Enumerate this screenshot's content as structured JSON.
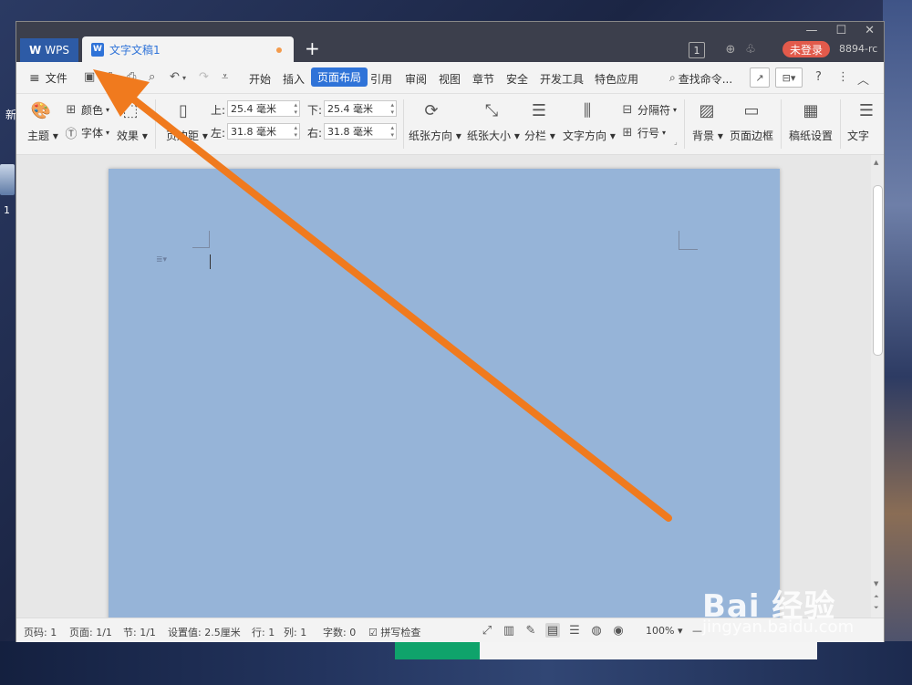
{
  "desktop": {
    "icon_text": "新",
    "icon_number": "1"
  },
  "titlebar": {
    "wps_tab": "WPS",
    "doc_tab": "文字文稿1",
    "doc_icon": "W",
    "new_tab": "+",
    "window_badge": "1",
    "login_button": "未登录",
    "account_id": "8894-rc"
  },
  "menu": {
    "file": "文件",
    "items": [
      "开始",
      "插入",
      "页面布局",
      "引用",
      "审阅",
      "视图",
      "章节",
      "安全",
      "开发工具",
      "特色应用"
    ],
    "active": "页面布局",
    "search": "查找命令..."
  },
  "ribbon": {
    "theme": "主题",
    "color": "颜色",
    "font": "字体",
    "effect": "效果",
    "margins": "页边距",
    "top_label": "上:",
    "top_value": "25.4 毫米",
    "bottom_label": "下:",
    "bottom_value": "25.4 毫米",
    "left_label": "左:",
    "left_value": "31.8 毫米",
    "right_label": "右:",
    "right_value": "31.8 毫米",
    "orientation": "纸张方向",
    "size": "纸张大小",
    "columns": "分栏",
    "text_direction": "文字方向",
    "breaks": "分隔符",
    "line_numbers": "行号",
    "background": "背景",
    "page_border": "页面边框",
    "paper_setup": "稿纸设置",
    "text_more": "文字"
  },
  "status": {
    "page_num": "页码: 1",
    "pages": "页面: 1/1",
    "section": "节: 1/1",
    "position": "设置值: 2.5厘米",
    "row": "行: 1",
    "col": "列: 1",
    "word_count": "字数: 0",
    "spell_check": "拼写检查",
    "zoom": "100%"
  },
  "watermark": {
    "brand": "Bai 经验",
    "url": "jingyan.baidu.com"
  },
  "colors": {
    "accent": "#2f73d8",
    "page_fill": "#96b4d8",
    "arrow": "#f07a1e",
    "login": "#e25a4b"
  }
}
